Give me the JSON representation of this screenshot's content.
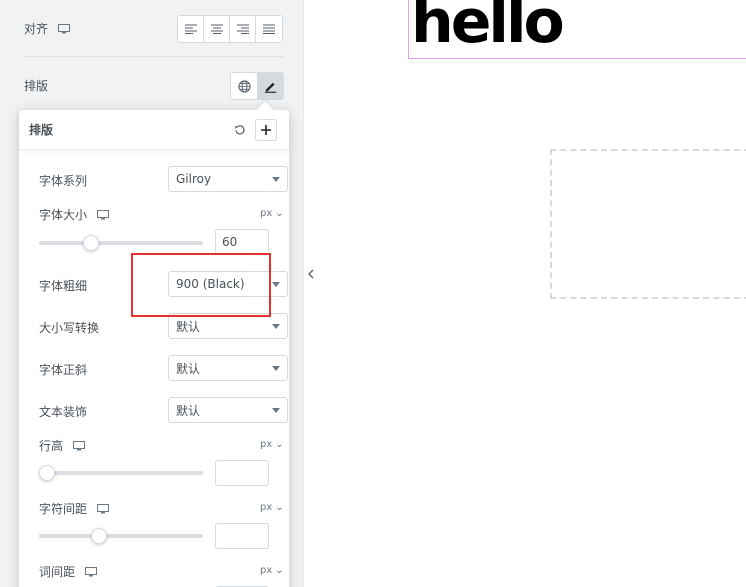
{
  "panel": {
    "align_label": "对齐",
    "typography_label": "排版"
  },
  "popover": {
    "title": "排版",
    "font_family": {
      "label": "字体系列",
      "value": "Gilroy"
    },
    "font_size": {
      "label": "字体大小",
      "unit": "px",
      "value": "60",
      "slider_fraction": 0.3
    },
    "font_weight": {
      "label": "字体粗细",
      "value": "900 (Black)"
    },
    "text_transform": {
      "label": "大小写转换",
      "value": "默认"
    },
    "font_style": {
      "label": "字体正斜",
      "value": "默认"
    },
    "text_decoration": {
      "label": "文本装饰",
      "value": "默认"
    },
    "line_height": {
      "label": "行高",
      "unit": "px",
      "value": "",
      "slider_fraction": 0.0
    },
    "letter_spacing": {
      "label": "字符间距",
      "unit": "px",
      "value": "",
      "slider_fraction": 0.35
    },
    "word_spacing": {
      "label": "词间距",
      "unit": "px"
    }
  },
  "canvas": {
    "heading_text": "hello"
  },
  "colors": {
    "highlight": "#e3322f",
    "selection_outline": "#e59ff0"
  }
}
